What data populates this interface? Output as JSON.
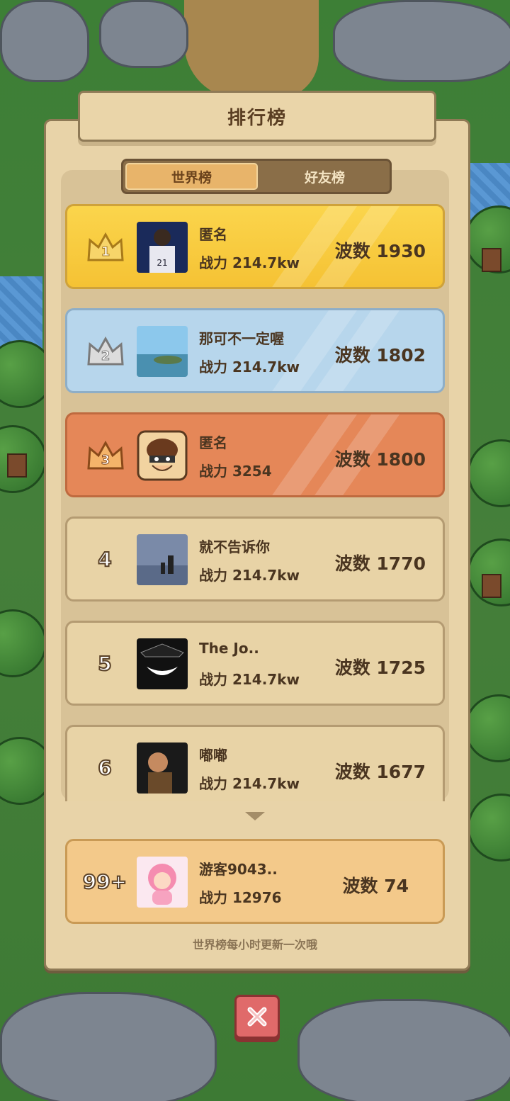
{
  "title": "排行榜",
  "tabs": [
    {
      "label": "世界榜",
      "active": true
    },
    {
      "label": "好友榜",
      "active": false
    }
  ],
  "rankings": [
    {
      "rank": "1",
      "name": "匿名",
      "power": "战力 214.7kw",
      "wave": "波数 1930",
      "avatar": "basketball-player-avatar",
      "tier": "gold"
    },
    {
      "rank": "2",
      "name": "那可不一定喔",
      "power": "战力 214.7kw",
      "wave": "波数 1802",
      "avatar": "seaside-landscape-avatar",
      "tier": "silver"
    },
    {
      "rank": "3",
      "name": "匿名",
      "power": "战力 3254",
      "wave": "波数 1800",
      "avatar": "default-cartoon-avatar",
      "tier": "bronze"
    },
    {
      "rank": "4",
      "name": "就不告诉你",
      "power": "战力 214.7kw",
      "wave": "波数 1770",
      "avatar": "beach-silhouette-avatar",
      "tier": "normal"
    },
    {
      "rank": "5",
      "name": "The Jo..",
      "power": "战力 214.7kw",
      "wave": "波数 1725",
      "avatar": "joker-avatar",
      "tier": "normal"
    },
    {
      "rank": "6",
      "name": "嘟嘟",
      "power": "战力 214.7kw",
      "wave": "波数 1677",
      "avatar": "child-photo-avatar",
      "tier": "normal"
    }
  ],
  "self": {
    "rank": "99+",
    "name": "游客9043..",
    "power": "战力 12976",
    "wave": "波数 74",
    "avatar": "pink-girl-avatar"
  },
  "footnote": "世界榜每小时更新一次哦",
  "colors": {
    "gold": "#fbd54c",
    "silver": "#b7d6ec",
    "bronze": "#e58758",
    "normal": "#e8d3a6",
    "self": "#f3c98a"
  }
}
